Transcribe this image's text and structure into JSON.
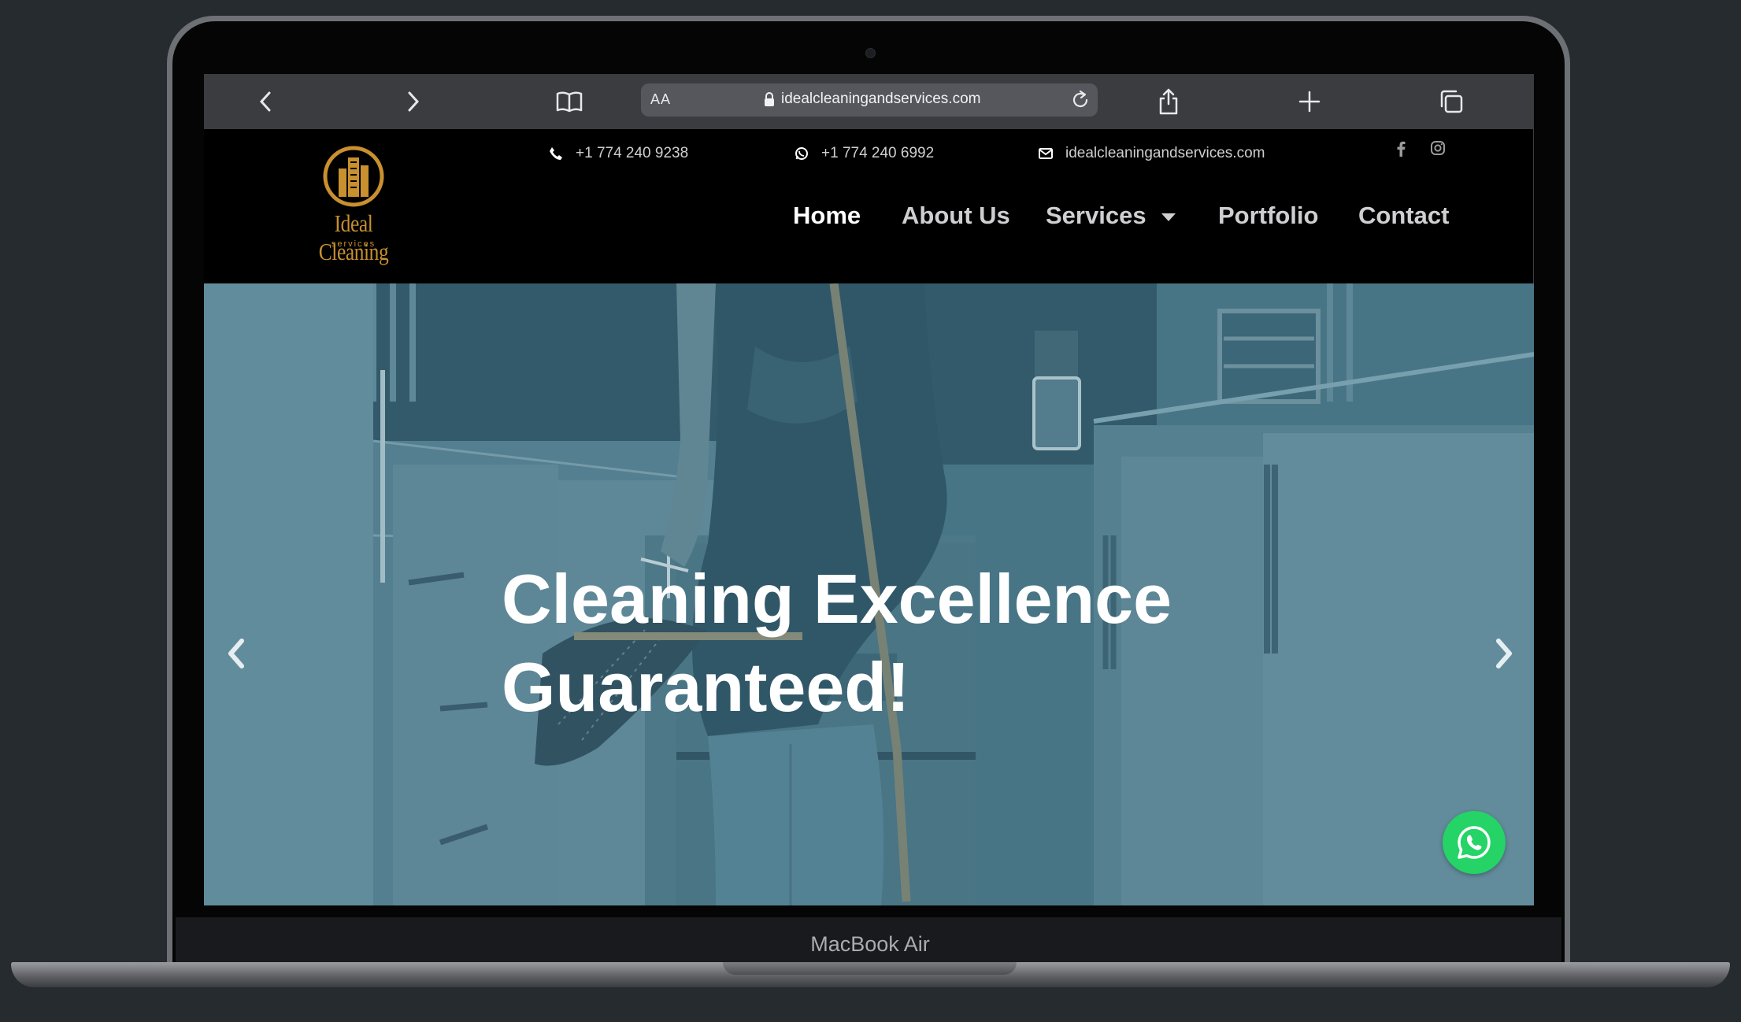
{
  "device": {
    "model_label": "MacBook Air"
  },
  "browser": {
    "text_size_label": "AA",
    "url": "idealcleaningandservices.com"
  },
  "site": {
    "logo": {
      "name": "Ideal Cleaning",
      "subtitle": "services"
    },
    "topbar": {
      "phone": "+1 774 240 9238",
      "whatsapp": "+1 774 240 6992",
      "email": "idealcleaningandservices.com"
    },
    "social": [
      "facebook-icon",
      "instagram-icon"
    ],
    "nav": {
      "items": [
        {
          "label": "Home",
          "active": true
        },
        {
          "label": "About Us",
          "active": false
        },
        {
          "label": "Services",
          "active": false,
          "has_dropdown": true
        },
        {
          "label": "Portfolio",
          "active": false
        },
        {
          "label": "Contact",
          "active": false
        }
      ]
    },
    "hero": {
      "title_line1": "Cleaning Excellence",
      "title_line2": "Guaranteed!"
    },
    "colors": {
      "brand_gold": "#c8902e",
      "hero_overlay": "#4a7686",
      "whatsapp_green": "#25d366"
    }
  }
}
